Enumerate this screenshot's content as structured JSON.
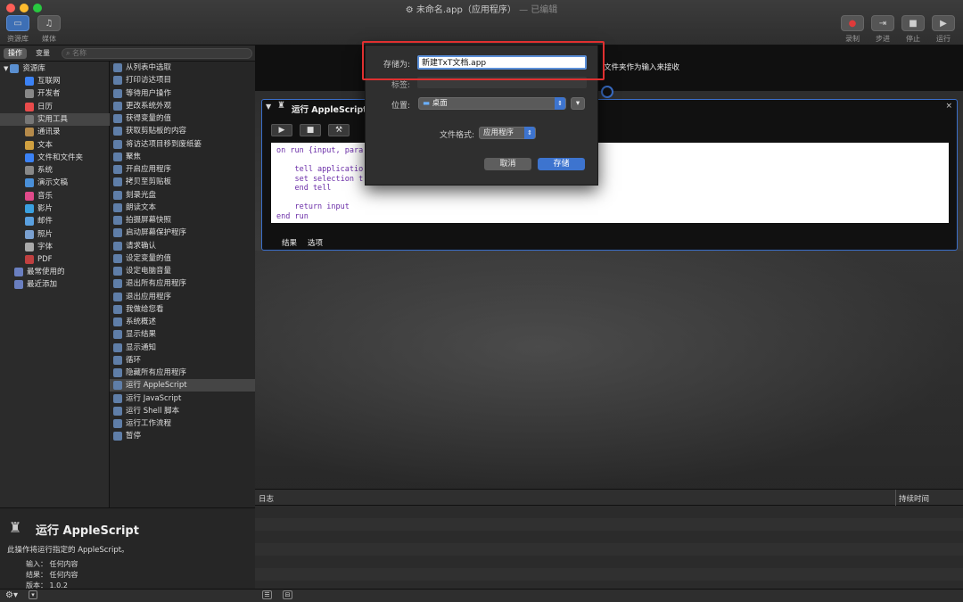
{
  "window": {
    "title": "未命名.app（应用程序）",
    "title_suffix": "— 已编辑"
  },
  "toolbar": {
    "left": [
      {
        "label": "资源库",
        "icon": "library-icon"
      },
      {
        "label": "媒体",
        "icon": "media-icon"
      }
    ],
    "right": [
      {
        "label": "录制",
        "icon": "record-icon"
      },
      {
        "label": "步进",
        "icon": "step-icon"
      },
      {
        "label": "停止",
        "icon": "stop-icon"
      },
      {
        "label": "运行",
        "icon": "run-icon"
      }
    ]
  },
  "left_pane": {
    "tab_actions": "操作",
    "tab_variables": "变量",
    "search_placeholder": "名称",
    "library_root": "资源库",
    "library_items": [
      "互联网",
      "开发者",
      "日历",
      "实用工具",
      "通讯录",
      "文本",
      "文件和文件夹",
      "系统",
      "演示文稿",
      "音乐",
      "影片",
      "邮件",
      "照片",
      "字体",
      "PDF"
    ],
    "library_selected": "实用工具",
    "extra_items": [
      "最常使用的",
      "最近添加"
    ],
    "actions": [
      "从列表中选取",
      "打印访达项目",
      "等待用户操作",
      "更改系统外观",
      "获得变量的值",
      "获取剪贴板的内容",
      "将访达项目移到废纸篓",
      "聚焦",
      "开启应用程序",
      "拷贝至剪贴板",
      "刻录光盘",
      "朗读文本",
      "拍摄屏幕快照",
      "启动屏幕保护程序",
      "请求确认",
      "设定变量的值",
      "设定电脑音量",
      "退出所有应用程序",
      "退出应用程序",
      "我做给您看",
      "系统概述",
      "显示结果",
      "显示通知",
      "循环",
      "隐藏所有应用程序",
      "运行 AppleScript",
      "运行 JavaScript",
      "运行 Shell 脚本",
      "运行工作流程",
      "暂停"
    ],
    "actions_selected": "运行 AppleScript"
  },
  "info": {
    "title": "运行 AppleScript",
    "description": "此操作将运行指定的 AppleScript。",
    "input_label": "输入：",
    "input_value": "任何内容",
    "result_label": "结果：",
    "result_value": "任何内容",
    "version_label": "版本：",
    "version_value": "1.0.2"
  },
  "workflow": {
    "receives_text": "文件夹作为输入来接收",
    "card_title": "运行 AppleScript",
    "code": "on run {input, para\n\n    tell applicatio\n    set selection t\n    end tell\n\n    return input\nend run",
    "tab_results": "结果",
    "tab_options": "选项"
  },
  "log": {
    "col_log": "日志",
    "col_duration": "持续时间"
  },
  "save_sheet": {
    "save_as_label": "存储为:",
    "save_as_value": "新建TxT文档.app",
    "tags_label": "标签:",
    "location_label": "位置:",
    "location_value": "桌面",
    "format_label": "文件格式:",
    "format_value": "应用程序",
    "cancel": "取消",
    "save": "存储"
  },
  "colors": {
    "accent": "#3d74cf",
    "highlight_box": "#e03030"
  }
}
